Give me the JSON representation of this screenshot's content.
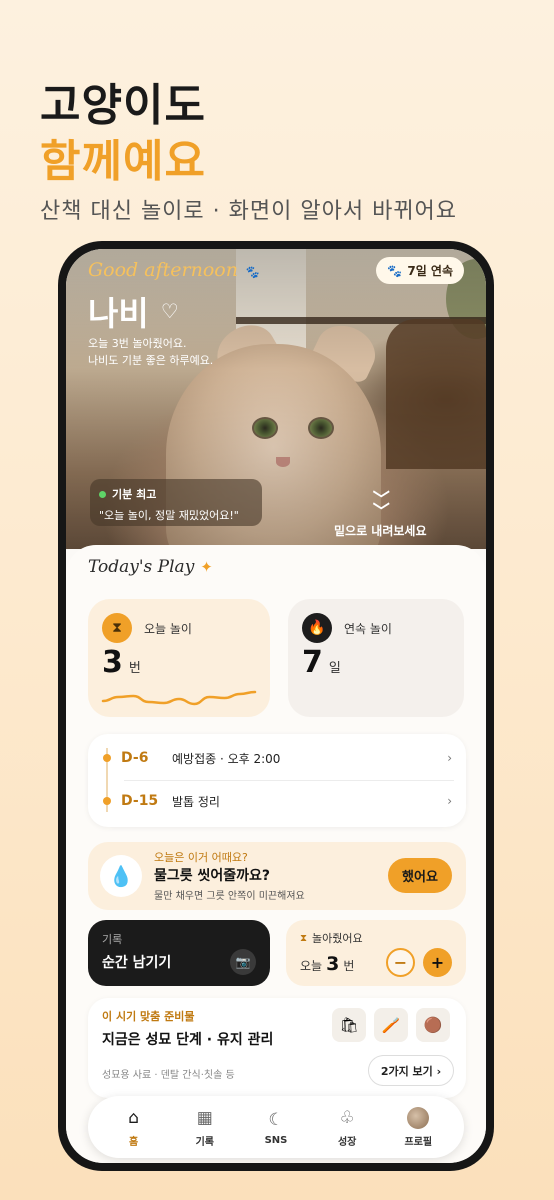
{
  "hero": {
    "line1": "고양이도",
    "line2": "함께예요",
    "subtitle": "산책 대신 놀이로 · 화면이 알아서 바뀌어요"
  },
  "header": {
    "greeting": "Good afternoon",
    "streak_badge": "7일 연속",
    "cat_name": "나비",
    "desc_line1": "오늘 3번 놀아줬어요.",
    "desc_line2": "나비도 기분 좋은 하루예요.",
    "mood_label": "기분 최고",
    "mood_quote": "\"오늘 놀이, 정말 재밌었어요!\"",
    "scroll_hint": "밑으로 내려보세요"
  },
  "today": {
    "title": "Today's Play",
    "stats": [
      {
        "label": "오늘 놀이",
        "value": "3",
        "unit": "번",
        "icon": "ribbon-icon"
      },
      {
        "label": "연속 놀이",
        "value": "7",
        "unit": "일",
        "icon": "flame-icon"
      }
    ],
    "sparkline": [
      0.35,
      0.55,
      0.6,
      0.3,
      0.25,
      0.45,
      0.2,
      0.55,
      0.5,
      0.7,
      0.8
    ]
  },
  "schedule": [
    {
      "dday": "D-6",
      "text": "예방접종 · 오후 2:00"
    },
    {
      "dday": "D-15",
      "text": "발톱 정리"
    }
  ],
  "tip": {
    "kicker": "오늘은 이거 어때요?",
    "title": "물그릇 씻어줄까요?",
    "sub": "물만 채우면 그릇 안쪽이 미끈해져요",
    "button": "했어요"
  },
  "record": {
    "label": "기록",
    "title": "순간 남기기"
  },
  "play_count": {
    "label": "놀아줬어요",
    "prefix": "오늘",
    "value": "3",
    "unit": "번"
  },
  "prep": {
    "kicker": "이 시기 맞춤 준비물",
    "title": "지금은 성묘 단계 · 유지 관리",
    "sub": "성묘용 사료 · 덴탈 간식·칫솔 등",
    "button": "2가지 보기 ›"
  },
  "tabs": [
    {
      "label": "홈",
      "icon": "home-icon",
      "active": true
    },
    {
      "label": "기록",
      "icon": "grid-icon",
      "active": false
    },
    {
      "label": "SNS",
      "icon": "sns-icon",
      "active": false
    },
    {
      "label": "성장",
      "icon": "sprout-icon",
      "active": false
    },
    {
      "label": "프로필",
      "icon": "avatar-icon",
      "active": false
    }
  ],
  "colors": {
    "accent": "#f0a028",
    "dark": "#1b1b1b",
    "cream": "#fcefdd"
  }
}
